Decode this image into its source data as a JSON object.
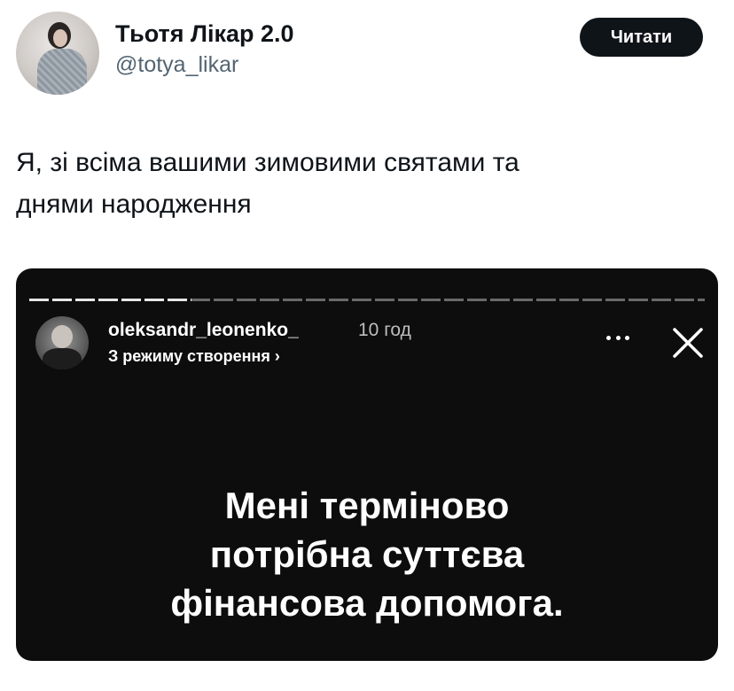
{
  "author": {
    "display_name": "Тьотя Лікар 2.0",
    "handle": "@totya_likar",
    "avatar_icon": "profile-photo"
  },
  "follow_button": {
    "label": "Читати"
  },
  "tweet": {
    "text_line1": "Я, зі всіма вашими зимовими святами та",
    "text_line2": "днями народження"
  },
  "story": {
    "username": "oleksandr_leonenko_",
    "time_ago": "10 год",
    "subtitle": "З режиму створення ›",
    "more_icon": "more-horizontal-icon",
    "close_icon": "close-icon",
    "progress_segments_done_fraction": 0.24,
    "text_line1": "Мені терміново",
    "text_line2": "потрібна суттєва",
    "text_line3": "фінансова допомога."
  },
  "colors": {
    "text_primary": "#0f1419",
    "text_secondary": "#536471",
    "button_bg": "#0f1419",
    "story_bg": "#0d0d0d"
  }
}
